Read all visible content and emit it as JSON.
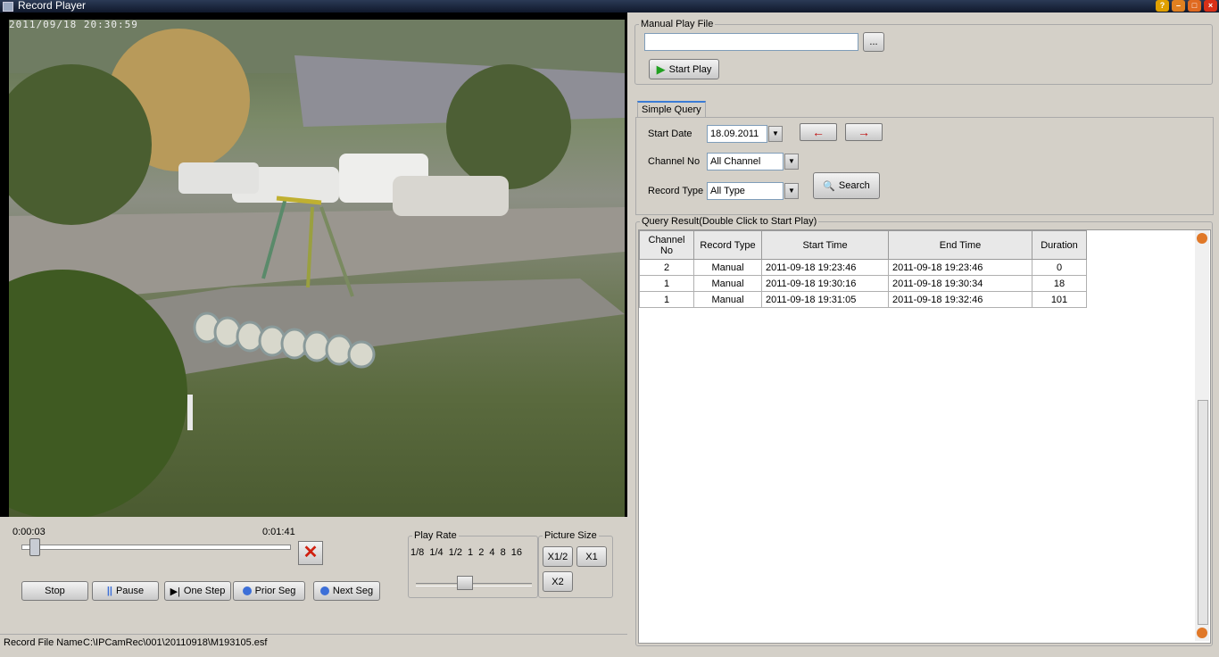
{
  "window": {
    "title": "Record Player"
  },
  "video": {
    "osd_timestamp": "2011/09/18  20:30:59"
  },
  "playback": {
    "current_time": "0:00:03",
    "total_time": "0:01:41",
    "progress_fraction": 0.03,
    "buttons": {
      "stop": "Stop",
      "pause": "Pause",
      "one_step": "One Step",
      "prior_seg": "Prior Seg",
      "next_seg": "Next Seg"
    }
  },
  "play_rate": {
    "title": "Play Rate",
    "labels": "1/8 1/4 1/2 1  2   4  8  16",
    "current": "1"
  },
  "picture_size": {
    "title": "Picture Size",
    "x_half": "X1/2",
    "x1": "X1",
    "x2": "X2"
  },
  "status": {
    "label": "Record File Name",
    "value": "C:\\IPCamRec\\001\\20110918\\M193105.esf"
  },
  "manual_play": {
    "title": "Manual Play File",
    "file_value": "",
    "browse": "...",
    "start_play": "Start Play"
  },
  "query": {
    "tab": "Simple Query",
    "start_date_label": "Start Date",
    "start_date": "18.09.2011",
    "channel_label": "Channel No",
    "channel": "All Channel",
    "record_type_label": "Record Type",
    "record_type": "All Type",
    "search": "Search"
  },
  "results": {
    "title": "Query Result(Double Click to Start Play)",
    "columns": [
      "Channel No",
      "Record Type",
      "Start Time",
      "End Time",
      "Duration"
    ],
    "rows": [
      [
        "2",
        "Manual",
        "2011-09-18 19:23:46",
        "2011-09-18 19:23:46",
        "0"
      ],
      [
        "1",
        "Manual",
        "2011-09-18 19:30:16",
        "2011-09-18 19:30:34",
        "18"
      ],
      [
        "1",
        "Manual",
        "2011-09-18 19:31:05",
        "2011-09-18 19:32:46",
        "101"
      ]
    ]
  }
}
